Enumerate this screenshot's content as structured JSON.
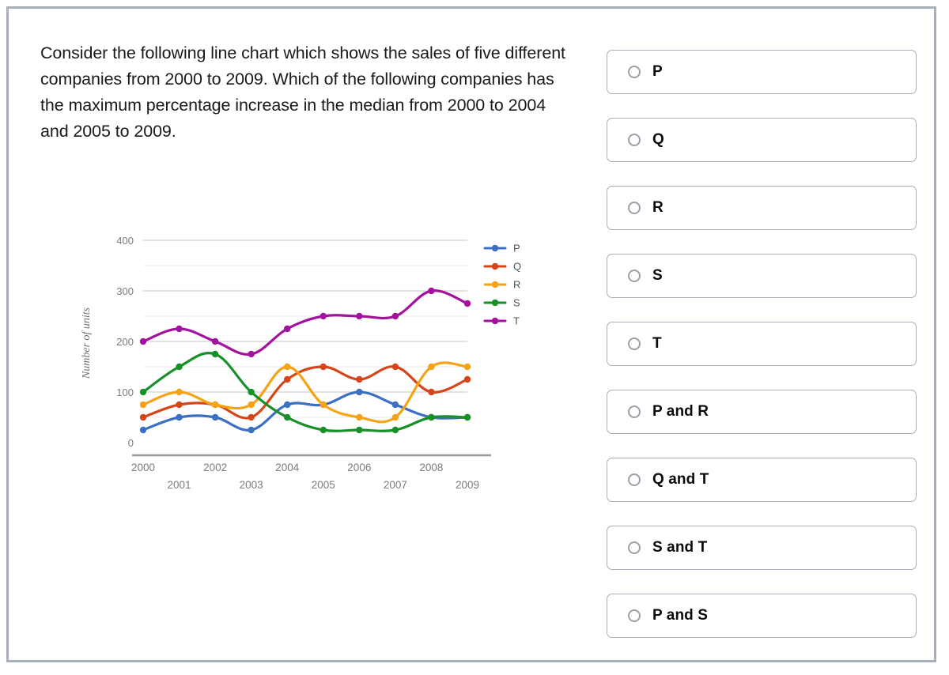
{
  "question": {
    "text": " Consider the following line chart which shows the sales of five different companies from 2000 to 2009. Which of the following companies has the maximum percentage increase in the median from 2000 to 2004 and 2005 to 2009."
  },
  "options": [
    {
      "id": "opt-p",
      "label": "P",
      "selected": false
    },
    {
      "id": "opt-q",
      "label": "Q",
      "selected": false
    },
    {
      "id": "opt-r",
      "label": "R",
      "selected": false
    },
    {
      "id": "opt-s",
      "label": "S",
      "selected": false
    },
    {
      "id": "opt-t",
      "label": "T",
      "selected": false
    },
    {
      "id": "opt-p-and-r",
      "label": "P and R",
      "selected": false
    },
    {
      "id": "opt-q-and-t",
      "label": "Q and T",
      "selected": false
    },
    {
      "id": "opt-s-and-t",
      "label": "S and T",
      "selected": false
    },
    {
      "id": "opt-p-and-s",
      "label": "P and S",
      "selected": false
    }
  ],
  "chart_data": {
    "type": "line",
    "title": "",
    "xlabel": "",
    "ylabel": "Number of units",
    "categories": [
      "2000",
      "2001",
      "2002",
      "2003",
      "2004",
      "2005",
      "2006",
      "2007",
      "2008",
      "2009"
    ],
    "ylim": [
      0,
      400
    ],
    "yticks": [
      0,
      100,
      200,
      300,
      400
    ],
    "yticklabels": [
      "0",
      "100",
      "200",
      "300",
      "400"
    ],
    "minor_gridlines": [
      50,
      150,
      250,
      350
    ],
    "grid": true,
    "legend_position": "right",
    "xtick_stagger": true,
    "series": [
      {
        "name": "P",
        "color": "#3b6fc4",
        "values": [
          25,
          50,
          50,
          25,
          75,
          75,
          100,
          75,
          50,
          50
        ]
      },
      {
        "name": "Q",
        "color": "#d64518",
        "values": [
          50,
          75,
          75,
          50,
          125,
          150,
          125,
          150,
          100,
          125
        ]
      },
      {
        "name": "R",
        "color": "#f5a314",
        "values": [
          75,
          100,
          75,
          75,
          150,
          75,
          50,
          50,
          150,
          150
        ]
      },
      {
        "name": "S",
        "color": "#189028",
        "values": [
          100,
          150,
          175,
          100,
          50,
          25,
          25,
          25,
          50,
          50
        ]
      },
      {
        "name": "T",
        "color": "#a2129f",
        "values": [
          200,
          225,
          200,
          175,
          225,
          250,
          250,
          250,
          300,
          275
        ]
      }
    ]
  },
  "colors": {
    "page_border": "#a8aeba",
    "option_border": "#a8aeba",
    "text": "#1a1a1a",
    "axis_text": "#7b7b7b",
    "gridline": "#d9d9d9"
  }
}
